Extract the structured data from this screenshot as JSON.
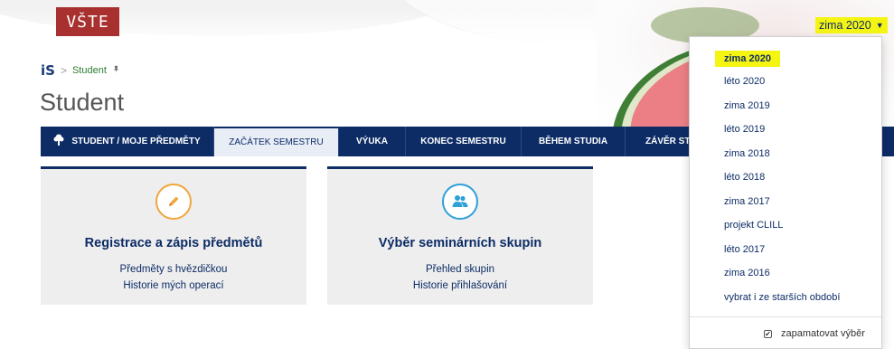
{
  "header": {
    "logo_text": "VŠTE",
    "semester_selected": "zima 2020"
  },
  "breadcrumb": {
    "app_logo": "iS",
    "separator": ">",
    "current": "Student",
    "pin_icon": "pin-icon"
  },
  "page": {
    "title": "Student"
  },
  "tabs": [
    {
      "label": "STUDENT / MOJE PŘEDMĚTY",
      "icon": "tree-icon"
    },
    {
      "label": "ZAČÁTEK SEMESTRU"
    },
    {
      "label": "VÝUKA"
    },
    {
      "label": "KONEC SEMESTRU"
    },
    {
      "label": "BĚHEM STUDIA"
    },
    {
      "label": "ZÁVĚR STU"
    }
  ],
  "cards": [
    {
      "icon": "pencil-icon",
      "icon_color": "#f0a63c",
      "title": "Registrace a zápis předmětů",
      "links": [
        "Předměty s hvězdičkou",
        "Historie mých operací"
      ]
    },
    {
      "icon": "people-icon",
      "icon_color": "#2ea0d8",
      "title": "Výběr seminárních skupin",
      "links": [
        "Přehled skupin",
        "Historie přihlašování"
      ]
    }
  ],
  "semester_dropdown": {
    "options": [
      "zima 2020",
      "léto 2020",
      "zima 2019",
      "léto 2019",
      "zima 2018",
      "léto 2018",
      "zima 2017",
      "projekt CLILL",
      "léto 2017",
      "zima 2016",
      "vybrat i ze starších období"
    ],
    "remember_label": "zapamatovat výběr",
    "remember_checked": true
  },
  "colors": {
    "navy": "#0d2c66",
    "highlight": "#f5f514",
    "brand_red": "#a8302e",
    "breadcrumb_green": "#2e7d32"
  }
}
